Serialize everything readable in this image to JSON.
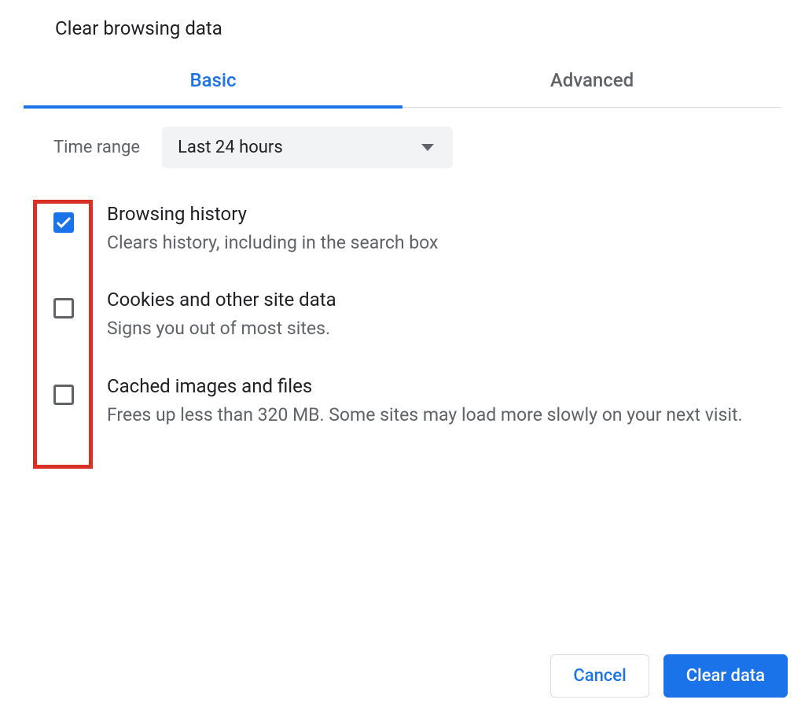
{
  "dialog": {
    "title": "Clear browsing data",
    "tabs": [
      {
        "label": "Basic",
        "active": true
      },
      {
        "label": "Advanced",
        "active": false
      }
    ],
    "timeRange": {
      "label": "Time range",
      "value": "Last 24 hours"
    },
    "options": [
      {
        "title": "Browsing history",
        "description": "Clears history, including in the search box",
        "checked": true
      },
      {
        "title": "Cookies and other site data",
        "description": "Signs you out of most sites.",
        "checked": false
      },
      {
        "title": "Cached images and files",
        "description": "Frees up less than 320 MB. Some sites may load more slowly on your next visit.",
        "checked": false
      }
    ],
    "buttons": {
      "cancel": "Cancel",
      "confirm": "Clear data"
    }
  }
}
